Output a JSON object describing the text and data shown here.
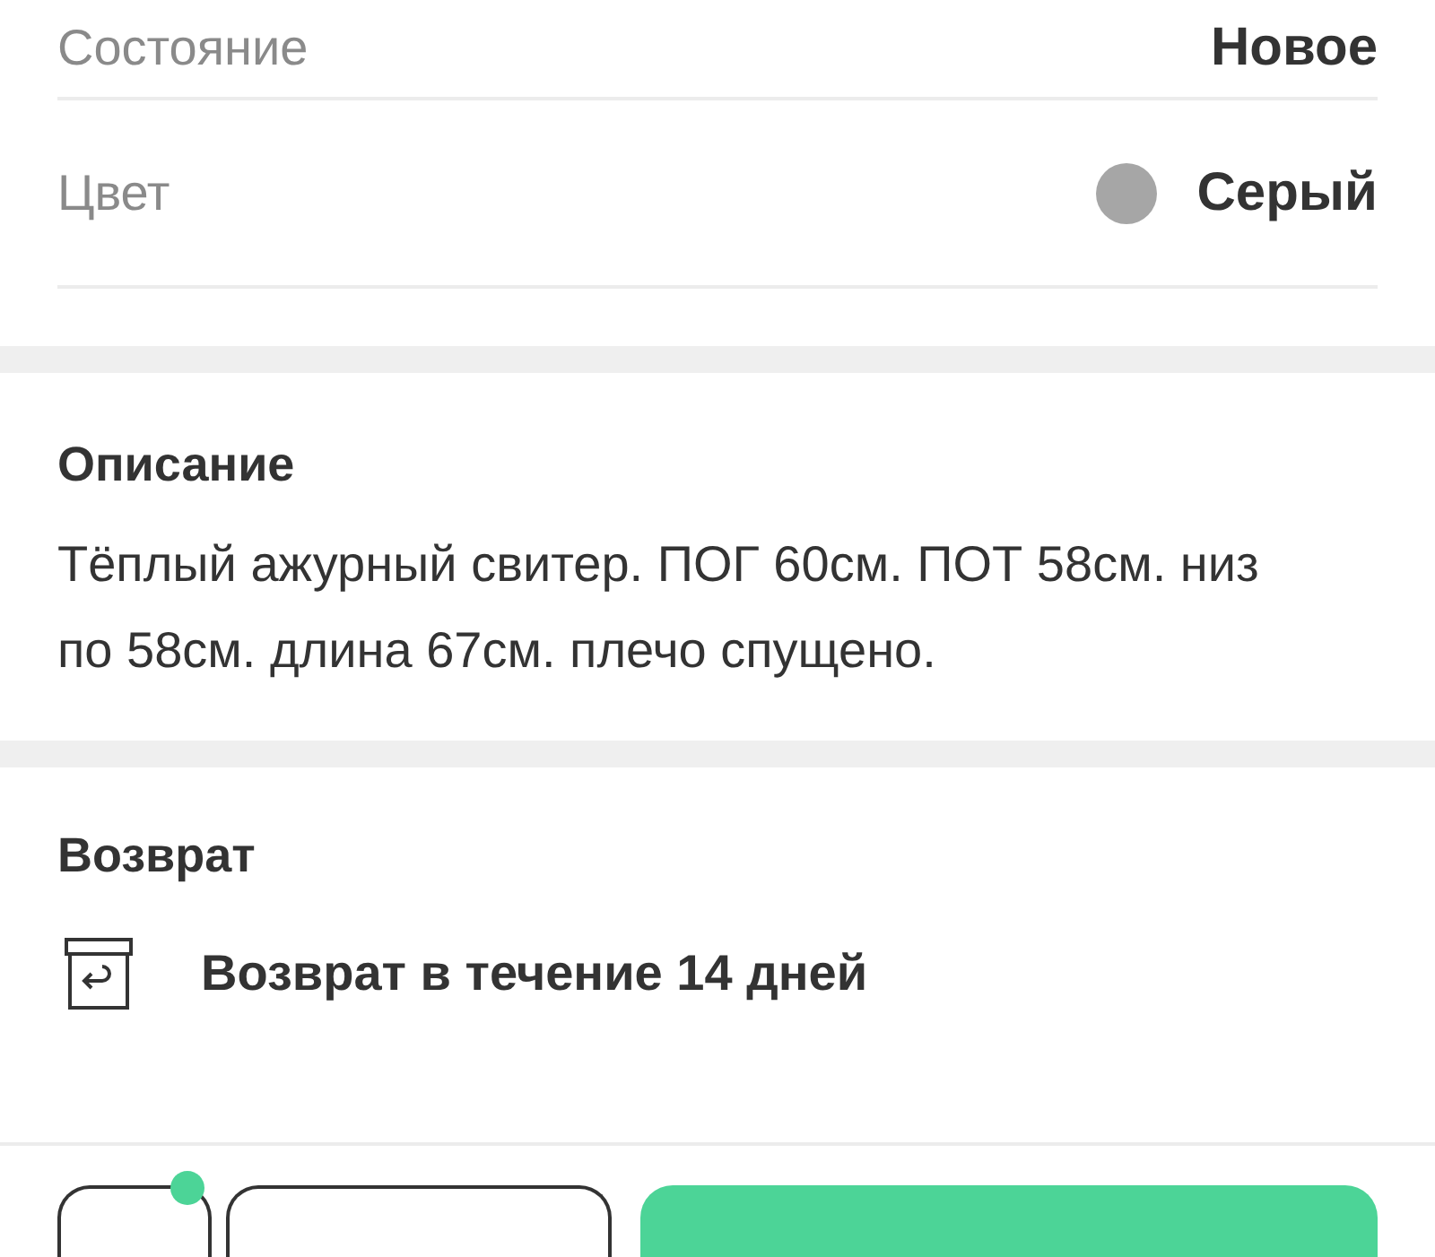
{
  "attributes": [
    {
      "kind": "text",
      "label": "Состояние",
      "value": "Новое"
    },
    {
      "kind": "color",
      "label": "Цвет",
      "value": "Серый",
      "color": "#a6a6a6"
    }
  ],
  "description": {
    "title": "Описание",
    "text": "Тёплый ажурный свитер. ПОГ 60см. ПОТ 58см. низ по 58см. длина 67см. плечо спущено."
  },
  "returns": {
    "title": "Возврат",
    "text": "Возврат в течение 14 дней"
  },
  "bottom_bar": {
    "first_button_badge": true
  }
}
